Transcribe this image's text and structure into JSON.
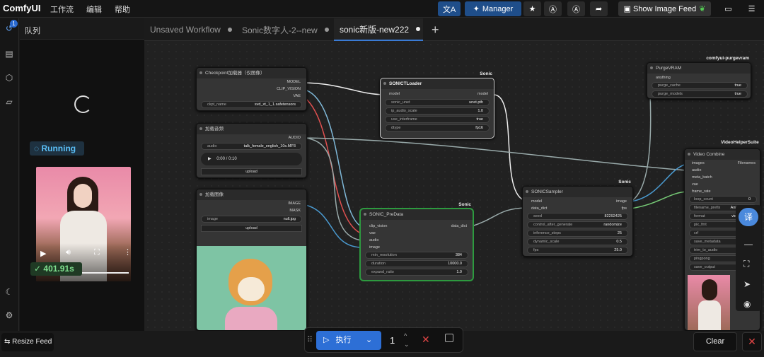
{
  "app": {
    "logo": "ComfyUI"
  },
  "menu": [
    "工作流",
    "编辑",
    "帮助"
  ],
  "topbar": {
    "manager_label": "Manager",
    "show_feed_label": "Show Image Feed"
  },
  "sidebar": {
    "queue_badge": "1"
  },
  "queue": {
    "title": "队列",
    "running_label": "Running",
    "duration": "401.91s"
  },
  "tabs": [
    {
      "label": "Unsaved Workflow"
    },
    {
      "label": "Sonic数字人-2--new"
    },
    {
      "label": "sonic新版-new222"
    }
  ],
  "nodes": {
    "checkpoint": {
      "title": "Checkpoint加载器（仅图像）",
      "out": [
        "MODEL",
        "CLIP_VISION",
        "VAE"
      ],
      "w_label": "ckpt_name",
      "w_value": "svd_xt_1_1.safetensors"
    },
    "audio": {
      "title": "加载音频",
      "out": "AUDIO",
      "w_label": "audio",
      "w_value": "talk_female_english_10s.MP3",
      "time": "0:00 / 0:10",
      "upload": "upload"
    },
    "image": {
      "title": "加载图像",
      "out": [
        "IMAGE",
        "MASK"
      ],
      "w_label": "image",
      "w_value": "null.jpg",
      "upload": "upload"
    },
    "loader": {
      "badge": "Sonic",
      "title": "SONICTLoader",
      "in": "model",
      "out": "model",
      "widgets": [
        [
          "sonic_unet",
          "unet.pth"
        ],
        [
          "ip_audio_scale",
          "1.0"
        ],
        [
          "use_interframe",
          "true"
        ],
        [
          "dtype",
          "fp16"
        ]
      ]
    },
    "predata": {
      "badge": "Sonic",
      "title": "SONIC_PreData",
      "in": [
        "clip_vision",
        "vae",
        "audio",
        "image"
      ],
      "out": "data_dict",
      "widgets": [
        [
          "min_resolution",
          "384"
        ],
        [
          "duration",
          "10000.0"
        ],
        [
          "expand_ratio",
          "1.0"
        ]
      ]
    },
    "sampler": {
      "badge": "Sonic",
      "title": "SONICSampler",
      "in": [
        "model",
        "data_dict"
      ],
      "out": [
        "image",
        "fps"
      ],
      "widgets": [
        [
          "seed",
          "82292425"
        ],
        [
          "control_after_generate",
          "randomize"
        ],
        [
          "inference_steps",
          "25"
        ],
        [
          "dynamic_scale",
          "0.5"
        ],
        [
          "fps",
          "25.0"
        ]
      ]
    },
    "purge": {
      "badge": "comfyui-purgevram",
      "title": "PurgeVRAM",
      "in": "anything",
      "widgets": [
        [
          "purge_cache",
          "true"
        ],
        [
          "purge_models",
          "true"
        ]
      ]
    },
    "combine": {
      "badge": "VideoHelperSuite",
      "title": "Video Combine",
      "in": [
        "images",
        "audio",
        "meta_batch",
        "vae",
        "frame_rate"
      ],
      "out": "Filenames",
      "widgets": [
        [
          "loop_count",
          "0"
        ],
        [
          "filename_prefix",
          "AnimateDiff"
        ],
        [
          "format",
          "video/h264"
        ],
        [
          "pix_fmt",
          "yuv4"
        ],
        [
          "crf",
          ""
        ],
        [
          "save_metadata",
          ""
        ],
        [
          "trim_to_audio",
          ""
        ],
        [
          "pingpong",
          ""
        ],
        [
          "save_output",
          ""
        ]
      ]
    }
  },
  "right_float": {
    "translate": "译"
  },
  "bottom": {
    "resize_feed": "Resize Feed",
    "run_label": "执行",
    "batch": "1",
    "clear_label": "Clear"
  }
}
